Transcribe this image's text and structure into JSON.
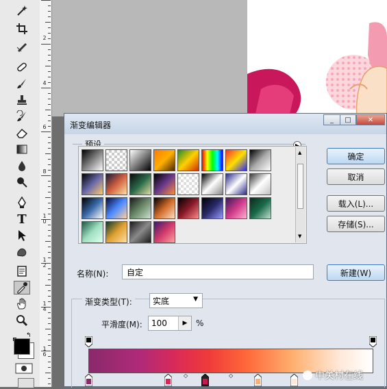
{
  "toolbox": {
    "tools": [
      "magic-wand",
      "crop",
      "slice",
      "healing-brush",
      "brush",
      "clone-stamp",
      "history-brush",
      "eraser",
      "gradient",
      "blur",
      "dodge",
      "pen",
      "type",
      "path-selection",
      "shape",
      "notes",
      "eyedropper",
      "hand",
      "zoom"
    ],
    "type_tool_glyph": "T",
    "active_tool": "eyedropper"
  },
  "ruler": {
    "labels": [
      "2",
      "4",
      "6",
      "8",
      "1\n0",
      "1\n2",
      "1\n4",
      "1\n6"
    ]
  },
  "dialog": {
    "title": "渐变编辑器",
    "presets_label": "预设",
    "name_label": "名称(N):",
    "name_value": "自定",
    "gradient_type_label": "渐变类型(T):",
    "gradient_type_value": "实底",
    "smoothness_label": "平滑度(M):",
    "smoothness_value": "100",
    "smoothness_unit": "%",
    "buttons": {
      "ok": "确定",
      "cancel": "取消",
      "load": "载入(L)...",
      "save": "存储(S)...",
      "new": "新建(W)"
    },
    "window_controls": {
      "minimize": "_",
      "maximize": "□",
      "close": "✕"
    }
  },
  "watermark": "中关村在线",
  "colors": {
    "dialog_bg": "#e1e6ee",
    "accent_border": "#3a78c8",
    "gradient_stops": [
      "#8a2a6a",
      "#b02a78",
      "#d82a5a",
      "#f03a3a",
      "#ff6a3a",
      "#ffb070",
      "#ffe8d8",
      "#ffffff"
    ]
  }
}
